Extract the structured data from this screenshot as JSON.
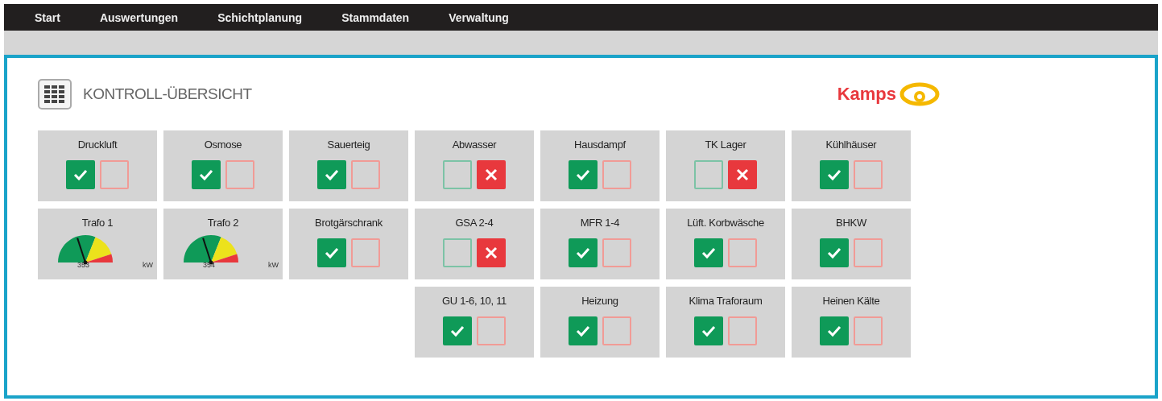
{
  "menu": [
    {
      "label": "Start"
    },
    {
      "label": "Auswertungen"
    },
    {
      "label": "Schichtplanung"
    },
    {
      "label": "Stammdaten"
    },
    {
      "label": "Verwaltung"
    }
  ],
  "page_title": "KONTROLL-ÜBERSICHT",
  "logo": {
    "text": "Kamps"
  },
  "rows": [
    [
      {
        "name": "Druckluft",
        "kind": "status",
        "ok": true
      },
      {
        "name": "Osmose",
        "kind": "status",
        "ok": true
      },
      {
        "name": "Sauerteig",
        "kind": "status",
        "ok": true
      },
      {
        "name": "Abwasser",
        "kind": "status",
        "ok": false
      },
      {
        "name": "Hausdampf",
        "kind": "status",
        "ok": true
      },
      {
        "name": "TK Lager",
        "kind": "status",
        "ok": false
      },
      {
        "name": "Kühlhäuser",
        "kind": "status",
        "ok": true
      }
    ],
    [
      {
        "name": "Trafo 1",
        "kind": "gauge",
        "level": 0.4,
        "reading": "353",
        "unit": "kW"
      },
      {
        "name": "Trafo 2",
        "kind": "gauge",
        "level": 0.4,
        "reading": "354",
        "unit": "kW"
      },
      {
        "name": "Brotgärschrank",
        "kind": "status",
        "ok": true
      },
      {
        "name": "GSA 2-4",
        "kind": "status",
        "ok": false
      },
      {
        "name": "MFR 1-4",
        "kind": "status",
        "ok": true
      },
      {
        "name": "Lüft. Korbwäsche",
        "kind": "status",
        "ok": true
      },
      {
        "name": "BHKW",
        "kind": "status",
        "ok": true
      }
    ],
    [
      {
        "name": "GU 1-6, 10, 11",
        "kind": "status",
        "ok": true
      },
      {
        "name": "Heizung",
        "kind": "status",
        "ok": true
      },
      {
        "name": "Klima Traforaum",
        "kind": "status",
        "ok": true
      },
      {
        "name": "Heinen Kälte",
        "kind": "status",
        "ok": true
      }
    ]
  ]
}
